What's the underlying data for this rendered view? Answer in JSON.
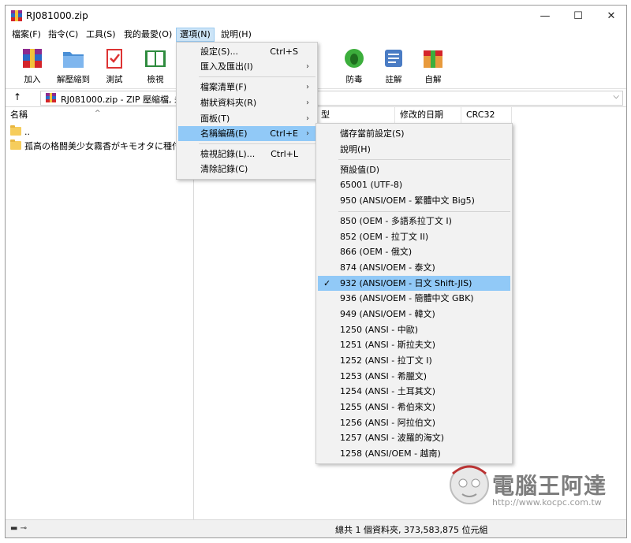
{
  "window": {
    "title": "RJ081000.zip"
  },
  "window_controls": {
    "minimize": "—",
    "maximize": "☐",
    "close": "✕"
  },
  "menubar": [
    "檔案(F)",
    "指令(C)",
    "工具(S)",
    "我的最愛(O)",
    "選項(N)",
    "說明(H)"
  ],
  "toolbar": [
    "加入",
    "解壓縮到",
    "測試",
    "檢視",
    "防毒",
    "註解",
    "自解"
  ],
  "address": {
    "up": "↑",
    "path": "RJ081000.zip - ZIP 壓縮檔, 未"
  },
  "columns": {
    "name": "名稱",
    "type": "型",
    "modified": "修改的日期",
    "crc": "CRC32"
  },
  "files": [
    "..",
    "孤高の格闘美少女霧香がキモオタに種付"
  ],
  "status": {
    "text": "總共 1 個資料夾, 373,583,875 位元組"
  },
  "options_menu": {
    "items": [
      {
        "label": "設定(S)...",
        "shortcut": "Ctrl+S",
        "submenu": false
      },
      {
        "label": "匯入及匯出(I)",
        "shortcut": "",
        "submenu": true
      },
      {
        "label": "檔案清單(F)",
        "shortcut": "",
        "submenu": true
      },
      {
        "label": "樹狀資料夾(R)",
        "shortcut": "",
        "submenu": true
      },
      {
        "label": "面板(T)",
        "shortcut": "",
        "submenu": true
      },
      {
        "label": "名稱編碼(E)",
        "shortcut": "Ctrl+E",
        "submenu": true,
        "highlighted": true
      },
      {
        "label": "檢視記錄(L)...",
        "shortcut": "Ctrl+L",
        "submenu": false
      },
      {
        "label": "清除記錄(C)",
        "shortcut": "",
        "submenu": false
      }
    ],
    "submenu_arrow": "›"
  },
  "encoding_menu": {
    "check_mark": "✓",
    "items": [
      "儲存當前設定(S)",
      "說明(H)",
      "預設值(D)",
      "65001 (UTF-8)",
      "950  (ANSI/OEM - 繁體中文 Big5)",
      "850  (OEM - 多語系拉丁文 I)",
      "852  (OEM - 拉丁文 II)",
      "866  (OEM - 俄文)",
      "874  (ANSI/OEM - 泰文)",
      "932  (ANSI/OEM - 日文 Shift-JIS)",
      "936  (ANSI/OEM - 簡體中文 GBK)",
      "949  (ANSI/OEM - 韓文)",
      "1250  (ANSI - 中歐)",
      "1251  (ANSI - 斯拉夫文)",
      "1252  (ANSI - 拉丁文 I)",
      "1253  (ANSI - 希臘文)",
      "1254  (ANSI - 土耳其文)",
      "1255  (ANSI - 希伯來文)",
      "1256  (ANSI - 阿拉伯文)",
      "1257  (ANSI - 波羅的海文)",
      "1258  (ANSI/OEM - 越南)"
    ],
    "selected": "932  (ANSI/OEM - 日文 Shift-JIS)"
  },
  "watermark": {
    "title": "電腦王阿達",
    "url": "http://www.kocpc.com.tw"
  },
  "colors": {
    "highlight": "#91c9f7",
    "menu_bg": "#f2f2f2",
    "active_menu": "#cce4f7"
  }
}
